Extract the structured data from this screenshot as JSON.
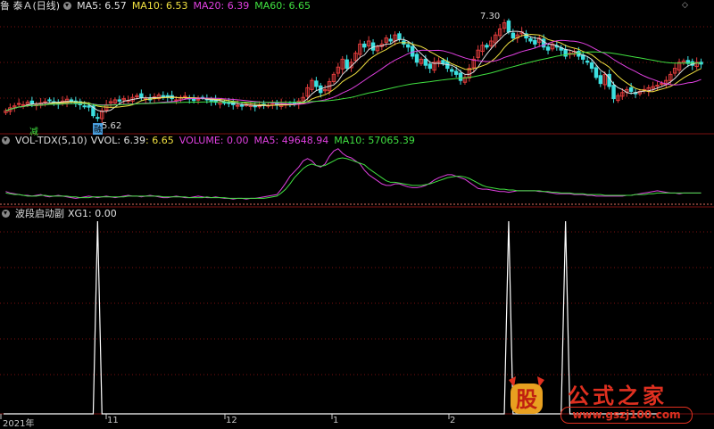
{
  "colors": {
    "up": "#e03c3c",
    "down": "#3ce0e0",
    "ma5": "#e0e0e0",
    "ma10": "#f0e040",
    "ma20": "#e040e0",
    "ma60": "#40e040",
    "vol": "#e0e0e0",
    "volma5": "#e040e0",
    "volma10": "#40e040",
    "grid": "#7a1010",
    "xg": "#ffffff"
  },
  "main_panel": {
    "title": "鲁 泰Ａ(日线)",
    "ma5": "MA5: 6.57",
    "ma10": "MA10: 6.53",
    "ma20": "MA20: 6.39",
    "ma60": "MA60: 6.65",
    "high_label": "7.30",
    "low_label": "5.62",
    "marker_reduce": "减",
    "marker_fin": "融"
  },
  "vol_panel": {
    "title": "VOL-TDX(5,10)",
    "vvol": "VVOL: 6.39",
    "vvol2": ": 6.65",
    "volume": "VOLUME: 0.00",
    "ma5": "MA5: 49648.94",
    "ma10": "MA10: 57065.39"
  },
  "xg_panel": {
    "title": "波段启动副",
    "xg1": "XG1: 0.00"
  },
  "x_axis": {
    "labels": [
      "2021年",
      "11",
      "12",
      "1",
      "2"
    ]
  },
  "watermark": {
    "gu": "股",
    "text": "公式之家",
    "url": "www.gszj100.com"
  },
  "icons": {
    "top_right": "chevron-up-icon",
    "dropdown": "chevron-down-circle-icon"
  },
  "chart_data": [
    {
      "type": "line",
      "name": "price",
      "title": "鲁 泰Ａ(日线)",
      "x": [
        0,
        1,
        2,
        3,
        4,
        5,
        6,
        7,
        8,
        9,
        10,
        11,
        12,
        13,
        14,
        15,
        16,
        17,
        18,
        19,
        20,
        21,
        22,
        23,
        24,
        25,
        26,
        27,
        28,
        29,
        30,
        31,
        32,
        33,
        34,
        35,
        36,
        37,
        38,
        39,
        40,
        41,
        42,
        43,
        44,
        45,
        46,
        47,
        48,
        49,
        50,
        51,
        52,
        53,
        54,
        55,
        56,
        57,
        58,
        59,
        60,
        61,
        62,
        63,
        64,
        65,
        66,
        67,
        68,
        69,
        70,
        71,
        72,
        73,
        74,
        75,
        76,
        77,
        78,
        79,
        80,
        81,
        82,
        83,
        84,
        85,
        86,
        87,
        88,
        89,
        90,
        91,
        92,
        93,
        94,
        95,
        96,
        97,
        98,
        99,
        100,
        101,
        102,
        103,
        104,
        105,
        106,
        107,
        108,
        109,
        110,
        111,
        112,
        113,
        114,
        115,
        116,
        117,
        118,
        119,
        120,
        121,
        122,
        123,
        124,
        125,
        126,
        127,
        128,
        129,
        130,
        131,
        132,
        133,
        134,
        135,
        136,
        137,
        138,
        139,
        140,
        141,
        142,
        143,
        144,
        145,
        146,
        147,
        148,
        149,
        150,
        151,
        152,
        153,
        154,
        155,
        156,
        157,
        158,
        159
      ],
      "close": [
        5.8,
        5.85,
        5.88,
        5.92,
        5.9,
        5.94,
        5.92,
        5.9,
        5.93,
        5.95,
        5.97,
        5.94,
        5.91,
        5.96,
        5.99,
        5.95,
        5.92,
        5.9,
        5.88,
        5.86,
        5.72,
        5.68,
        5.8,
        5.9,
        5.95,
        5.98,
        5.96,
        6.0,
        5.97,
        6.02,
        6.05,
        6.02,
        6.0,
        5.98,
        6.03,
        6.06,
        6.04,
        6.02,
        6.0,
        5.98,
        6.02,
        6.04,
        6.0,
        5.97,
        5.99,
        6.02,
        5.98,
        5.96,
        5.94,
        5.95,
        5.93,
        5.92,
        5.9,
        5.89,
        5.88,
        5.9,
        5.89,
        5.87,
        5.88,
        5.9,
        5.89,
        5.91,
        5.9,
        5.92,
        5.91,
        5.9,
        5.93,
        5.96,
        6.02,
        6.18,
        6.3,
        6.2,
        6.1,
        6.15,
        6.28,
        6.4,
        6.52,
        6.65,
        6.5,
        6.6,
        6.75,
        6.9,
        6.85,
        6.95,
        6.8,
        6.85,
        6.9,
        7.0,
        6.95,
        7.05,
        6.98,
        6.9,
        6.85,
        6.7,
        6.6,
        6.65,
        6.55,
        6.5,
        6.6,
        6.62,
        6.58,
        6.5,
        6.45,
        6.4,
        6.3,
        6.35,
        6.5,
        6.65,
        6.8,
        6.88,
        6.85,
        6.95,
        7.05,
        7.15,
        7.25,
        7.1,
        7.0,
        7.05,
        7.1,
        7.0,
        6.95,
        6.9,
        7.0,
        6.85,
        6.8,
        6.9,
        6.85,
        6.8,
        6.7,
        6.75,
        6.78,
        6.7,
        6.65,
        6.6,
        6.5,
        6.35,
        6.25,
        6.4,
        6.2,
        6.0,
        6.05,
        6.1,
        6.15,
        6.12,
        6.08,
        6.12,
        6.15,
        6.18,
        6.2,
        6.22,
        6.25,
        6.3,
        6.4,
        6.5,
        6.6,
        6.62,
        6.58,
        6.55,
        6.6,
        6.57
      ],
      "ylim": [
        5.45,
        7.45
      ]
    },
    {
      "type": "line",
      "name": "volume",
      "title": "VOL-TDX(5,10)",
      "series": [
        {
          "name": "MA5",
          "values": [
            52,
            50,
            49,
            48,
            47,
            47,
            46,
            47,
            48,
            46,
            45,
            46,
            47,
            46,
            45,
            44,
            43,
            44,
            45,
            46,
            45,
            44,
            45,
            46,
            45,
            44,
            45,
            46,
            47,
            46,
            46,
            45,
            46,
            47,
            46,
            45,
            44,
            44,
            45,
            46,
            45,
            44,
            44,
            45,
            46,
            45,
            44,
            44,
            45,
            44,
            43,
            43,
            42,
            43,
            43,
            42,
            43,
            43,
            44,
            45,
            46,
            47,
            48,
            55,
            63,
            72,
            78,
            84,
            92,
            95,
            92,
            86,
            84,
            88,
            98,
            105,
            108,
            102,
            98,
            96,
            92,
            88,
            80,
            74,
            70,
            66,
            62,
            60,
            60,
            62,
            62,
            60,
            58,
            57,
            57,
            58,
            60,
            63,
            67,
            70,
            72,
            74,
            74,
            72,
            70,
            68,
            64,
            60,
            56,
            55,
            55,
            54,
            53,
            52,
            52,
            51,
            52,
            53,
            53,
            53,
            53,
            53,
            52,
            52,
            51,
            50,
            49,
            49,
            49,
            49,
            48,
            48,
            48,
            47,
            47,
            46,
            46,
            46,
            46,
            46,
            46,
            46,
            47,
            47,
            48,
            49,
            50,
            51,
            52,
            53,
            52,
            51,
            50,
            50,
            49,
            50,
            50,
            50,
            50,
            50
          ]
        },
        {
          "name": "MA10",
          "values": [
            50,
            49,
            48,
            48,
            47,
            46,
            46,
            46,
            47,
            47,
            46,
            46,
            46,
            46,
            46,
            45,
            45,
            44,
            44,
            44,
            45,
            45,
            45,
            45,
            45,
            45,
            45,
            45,
            46,
            46,
            46,
            46,
            46,
            46,
            46,
            46,
            45,
            45,
            45,
            45,
            45,
            45,
            44,
            44,
            44,
            44,
            45,
            44,
            44,
            44,
            44,
            43,
            43,
            43,
            43,
            43,
            43,
            43,
            43,
            43,
            44,
            45,
            46,
            50,
            55,
            62,
            70,
            76,
            82,
            86,
            88,
            86,
            85,
            86,
            89,
            92,
            95,
            96,
            95,
            93,
            91,
            89,
            87,
            82,
            78,
            74,
            70,
            66,
            64,
            64,
            63,
            62,
            61,
            60,
            60,
            60,
            61,
            62,
            64,
            66,
            68,
            70,
            71,
            72,
            72,
            71,
            69,
            66,
            63,
            60,
            58,
            57,
            56,
            55,
            55,
            54,
            54,
            53,
            53,
            53,
            53,
            53,
            53,
            52,
            52,
            51,
            51,
            50,
            50,
            50,
            49,
            49,
            49,
            48,
            48,
            48,
            48,
            47,
            47,
            47,
            47,
            47,
            47,
            47,
            48,
            48,
            48,
            49,
            49,
            50,
            50,
            50,
            50,
            50,
            50,
            50,
            50,
            50,
            50,
            50
          ]
        }
      ]
    },
    {
      "type": "line",
      "name": "XG1",
      "title": "波段启动副",
      "series": [
        {
          "name": "XG1",
          "spikes_at": [
            21,
            115,
            128
          ]
        }
      ],
      "ylim": [
        0,
        1
      ]
    }
  ]
}
